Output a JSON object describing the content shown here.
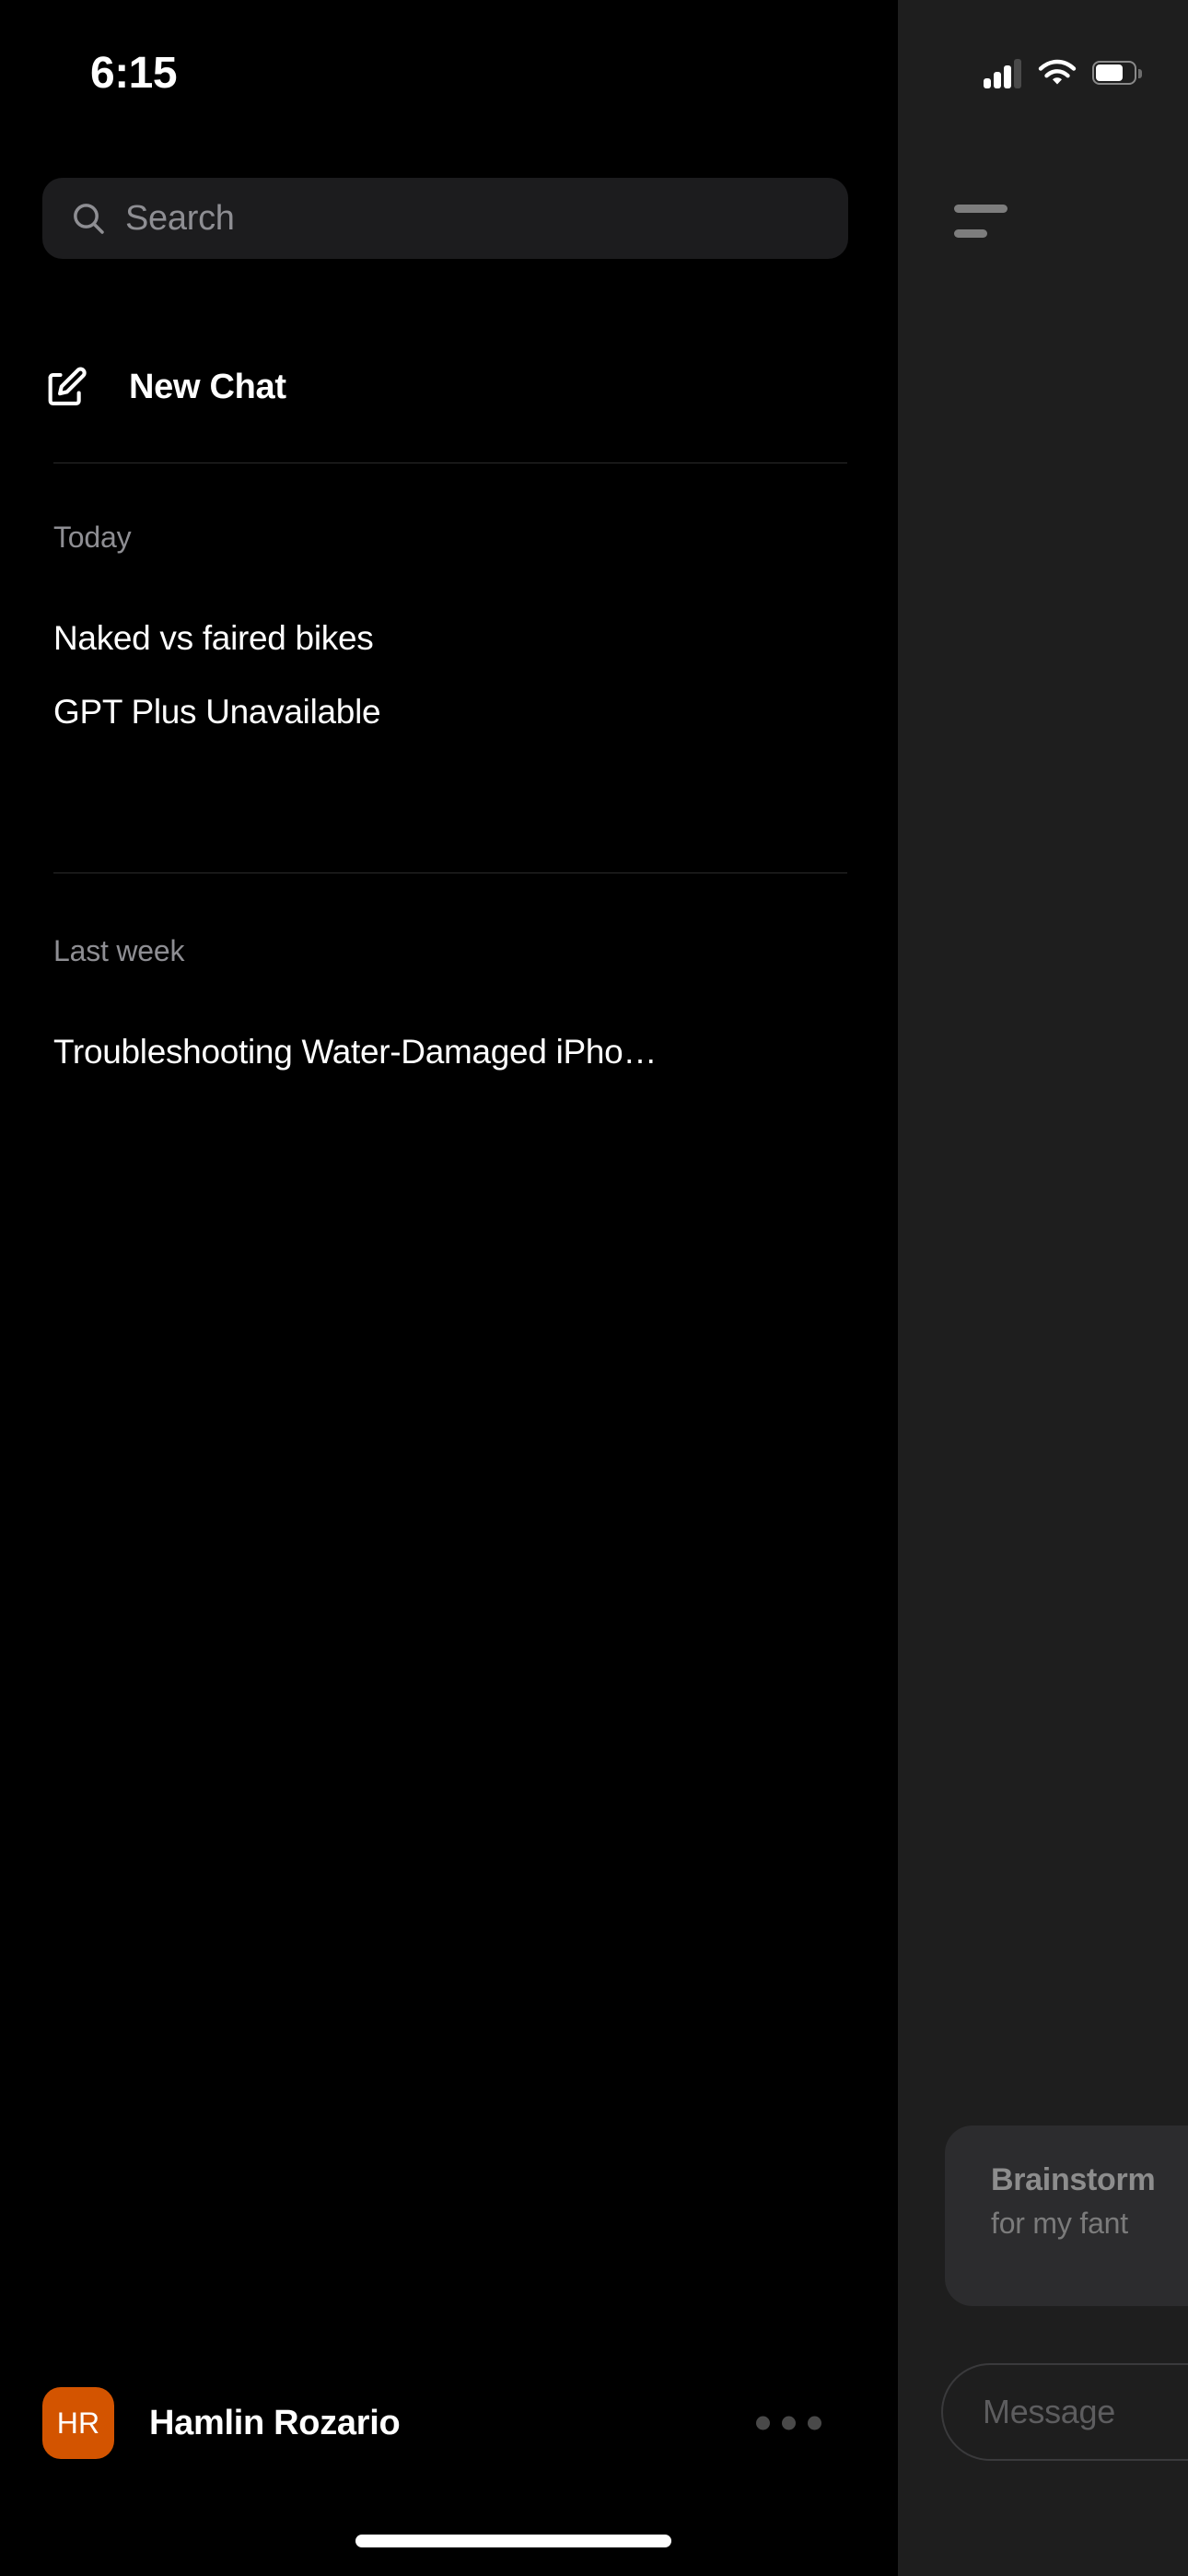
{
  "status_bar": {
    "time": "6:15",
    "cellular_icon": "cellular-bars-icon",
    "cellular_bars_active": 3,
    "cellular_bars_total": 4,
    "wifi_icon": "wifi-icon",
    "battery_icon": "battery-icon",
    "battery_level_percent": 70
  },
  "drawer": {
    "search": {
      "icon": "search-icon",
      "placeholder": "Search",
      "value": ""
    },
    "new_chat": {
      "icon": "compose-icon",
      "label": "New Chat"
    },
    "sections": [
      {
        "label": "Today",
        "items": [
          {
            "title": "Naked vs faired bikes"
          },
          {
            "title": "GPT Plus Unavailable"
          }
        ]
      },
      {
        "label": "Last week",
        "items": [
          {
            "title": "Troubleshooting Water-Damaged iPho…"
          }
        ]
      }
    ],
    "profile": {
      "avatar_initials": "HR",
      "avatar_color": "#d35400",
      "name": "Hamlin Rozario",
      "more_icon": "ellipsis-icon"
    }
  },
  "chat_backdrop": {
    "menu_icon": "hamburger-menu-icon",
    "suggestion_card": {
      "title": "Brainstorm",
      "subtitle": "for my fant"
    },
    "composer": {
      "placeholder": "Message"
    }
  },
  "home_indicator": {
    "name": "home-indicator"
  }
}
